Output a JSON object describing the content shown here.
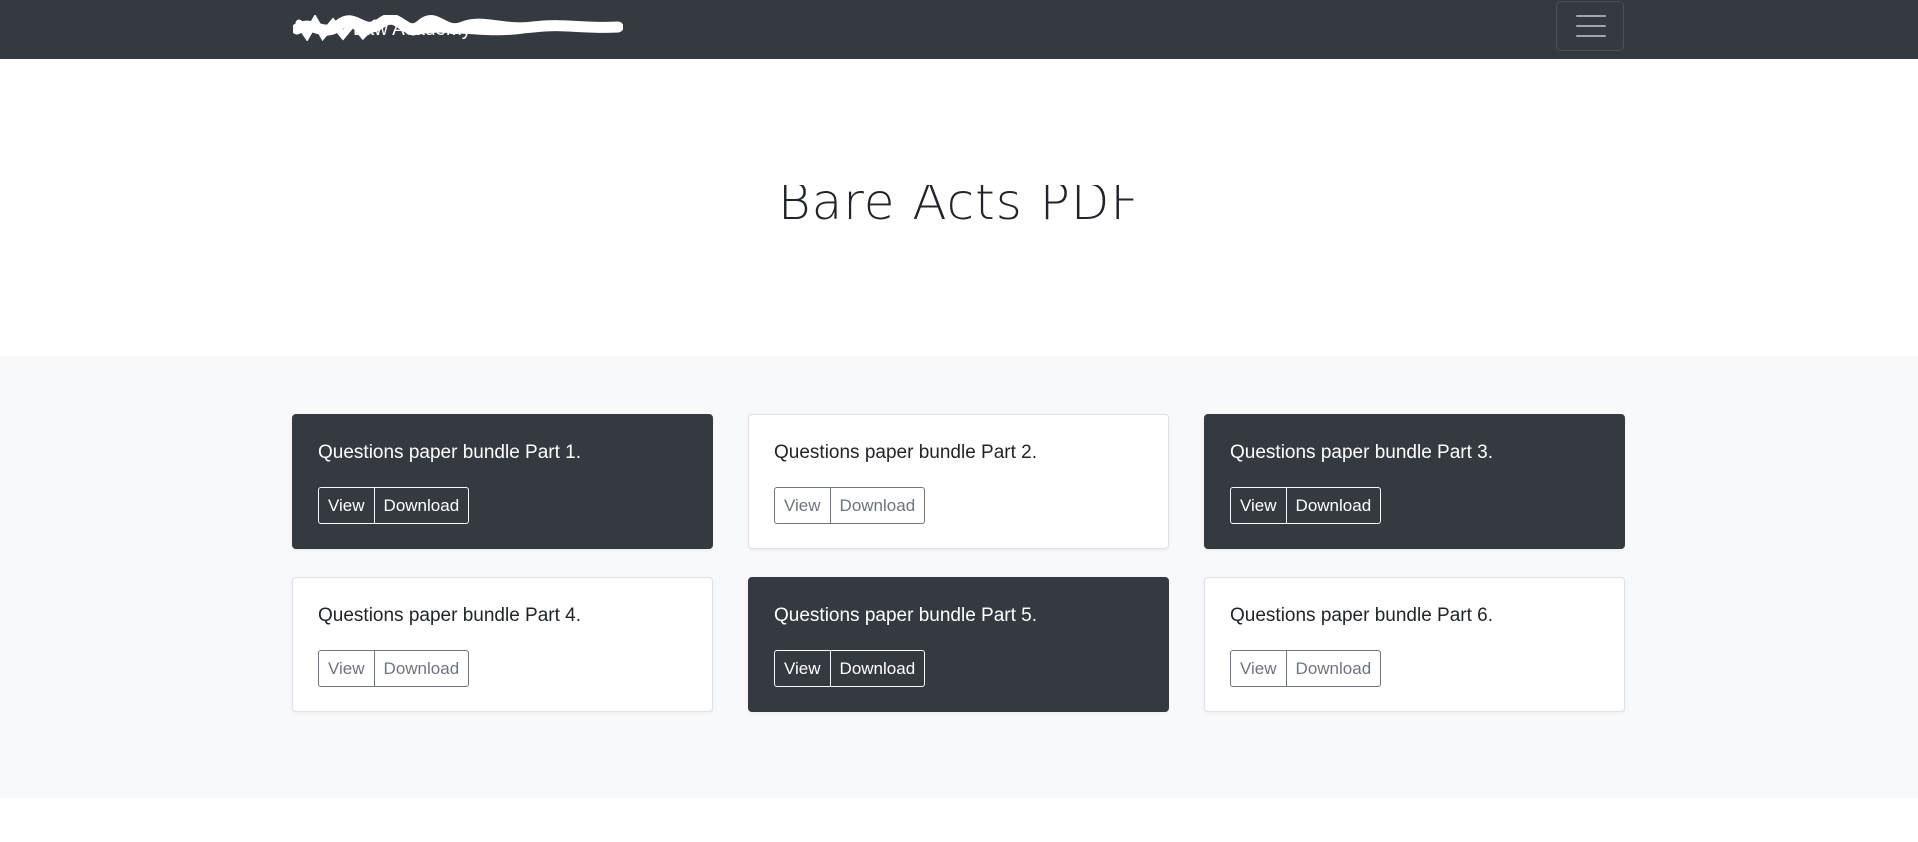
{
  "navbar": {
    "brand": "Law Academy",
    "menu_icon": "hamburger-menu-icon"
  },
  "hero": {
    "title": "Bare Acts PDF"
  },
  "cards": [
    {
      "title": "Questions paper bundle Part 1.",
      "view_label": "View",
      "download_label": "Download",
      "theme": "dark"
    },
    {
      "title": "Questions paper bundle Part 2.",
      "view_label": "View",
      "download_label": "Download",
      "theme": "light"
    },
    {
      "title": "Questions paper bundle Part 3.",
      "view_label": "View",
      "download_label": "Download",
      "theme": "dark"
    },
    {
      "title": "Questions paper bundle Part 4.",
      "view_label": "View",
      "download_label": "Download",
      "theme": "light"
    },
    {
      "title": "Questions paper bundle Part 5.",
      "view_label": "View",
      "download_label": "Download",
      "theme": "dark"
    },
    {
      "title": "Questions paper bundle Part 6.",
      "view_label": "View",
      "download_label": "Download",
      "theme": "light"
    }
  ],
  "colors": {
    "navbar_bg": "#343a40",
    "dark_card_bg": "#343a40",
    "album_bg": "#f8f9fa",
    "muted_button": "#6c757d"
  }
}
